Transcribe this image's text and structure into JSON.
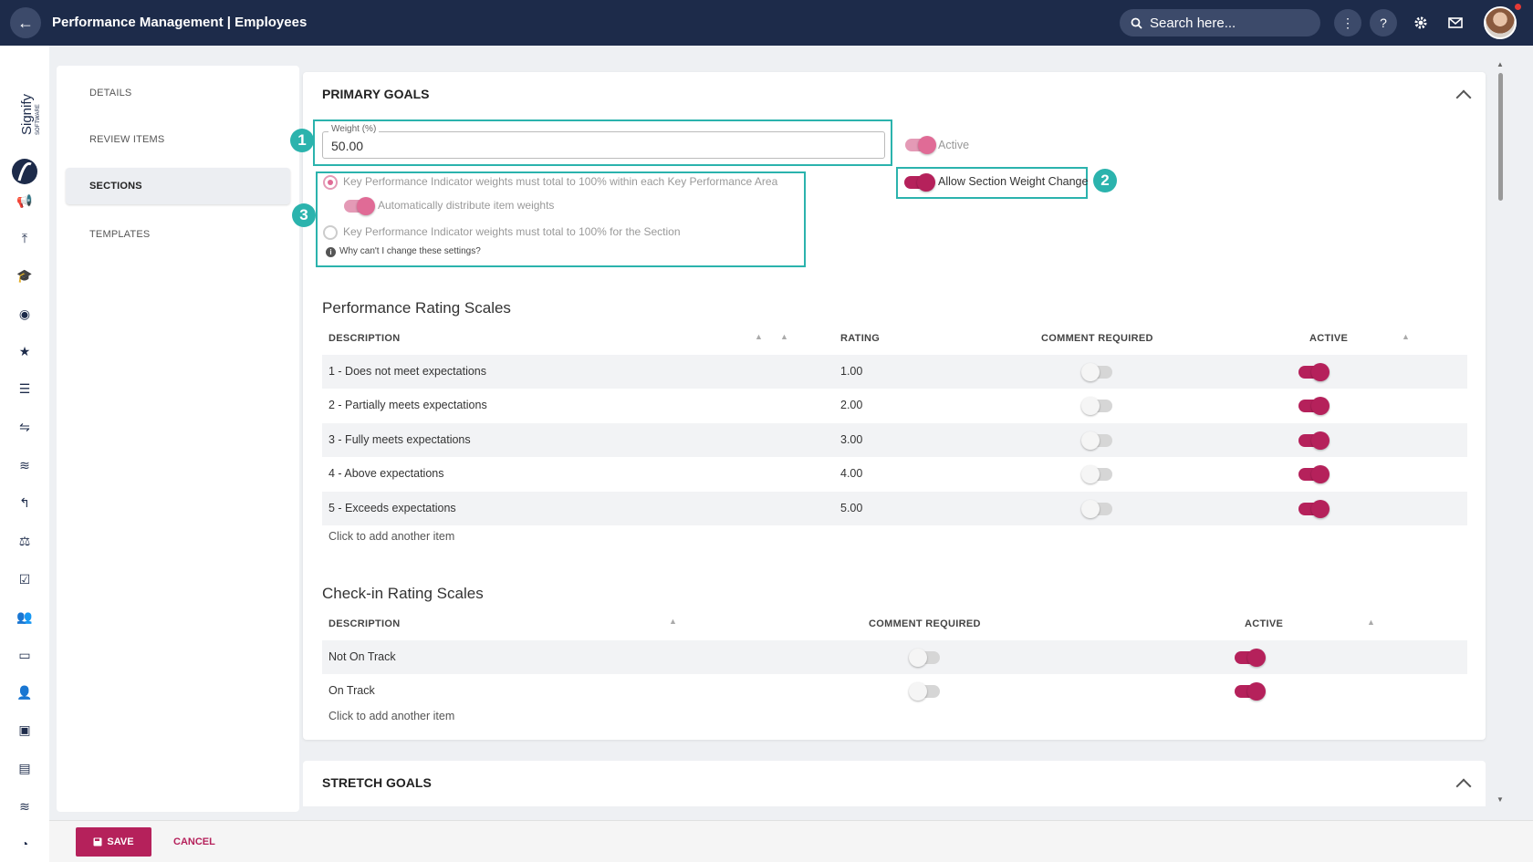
{
  "header": {
    "title": "Performance Management | Employees",
    "search_placeholder": "Search here..."
  },
  "menu": {
    "items": [
      "DETAILS",
      "REVIEW ITEMS",
      "SECTIONS",
      "TEMPLATES"
    ],
    "active": "SECTIONS"
  },
  "primary_goals": {
    "title": "PRIMARY GOALS",
    "weight_label": "Weight (%)",
    "weight_value": "50.00",
    "active_label": "Active",
    "allow_change_label": "Allow Section Weight Change",
    "kpi_area_option": "Key Performance Indicator weights must total to 100% within each Key Performance Area",
    "auto_distribute_label": "Automatically distribute item weights",
    "kpi_section_option": "Key Performance Indicator weights must total to 100% for the Section",
    "why_link": "Why can't I change these settings?",
    "badges": [
      "1",
      "2",
      "3"
    ]
  },
  "performance_rating": {
    "title": "Performance Rating Scales",
    "headers": {
      "description": "DESCRIPTION",
      "rating": "RATING",
      "comment": "COMMENT REQUIRED",
      "active": "ACTIVE"
    },
    "rows": [
      {
        "description": "1 - Does not meet expectations",
        "rating": "1.00",
        "comment_required": false,
        "active": true
      },
      {
        "description": "2 - Partially meets expectations",
        "rating": "2.00",
        "comment_required": false,
        "active": true
      },
      {
        "description": "3 - Fully meets expectations",
        "rating": "3.00",
        "comment_required": false,
        "active": true
      },
      {
        "description": "4 - Above expectations",
        "rating": "4.00",
        "comment_required": false,
        "active": true
      },
      {
        "description": "5 - Exceeds expectations",
        "rating": "5.00",
        "comment_required": false,
        "active": true
      }
    ],
    "add_item": "Click to add another item"
  },
  "checkin_rating": {
    "title": "Check-in Rating Scales",
    "headers": {
      "description": "DESCRIPTION",
      "comment": "COMMENT REQUIRED",
      "active": "ACTIVE"
    },
    "rows": [
      {
        "description": "Not On Track",
        "comment_required": false,
        "active": true
      },
      {
        "description": "On Track",
        "comment_required": false,
        "active": true
      }
    ],
    "add_item": "Click to add another item"
  },
  "stretch_goals": {
    "title": "STRETCH GOALS"
  },
  "footer": {
    "save": "SAVE",
    "cancel": "CANCEL"
  },
  "colors": {
    "primary": "#b5215b",
    "topbar": "#1d2b4a",
    "highlight": "#2bb3ad"
  }
}
